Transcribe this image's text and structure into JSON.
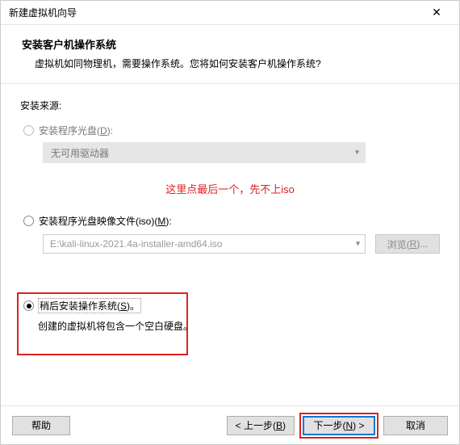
{
  "window": {
    "title": "新建虚拟机向导"
  },
  "header": {
    "title": "安装客户机操作系统",
    "subtitle": "虚拟机如同物理机，需要操作系统。您将如何安装客户机操作系统?"
  },
  "source_label": "安装来源:",
  "opt1": {
    "label_pre": "安装程序光盘(",
    "hotkey": "D",
    "label_post": "):",
    "drive": "无可用驱动器"
  },
  "annotation": "这里点最后一个，先不上iso",
  "opt2": {
    "label_pre": "安装程序光盘映像文件(iso)(",
    "hotkey": "M",
    "label_post": "):",
    "path": "E:\\kali-linux-2021.4a-installer-amd64.iso",
    "browse_pre": "浏览(",
    "browse_hot": "R",
    "browse_post": ")..."
  },
  "opt3": {
    "label_pre": "稍后安装操作系统(",
    "hotkey": "S",
    "label_post": ")。",
    "desc": "创建的虚拟机将包含一个空白硬盘。"
  },
  "footer": {
    "help": "帮助",
    "back_pre": "< 上一步(",
    "back_hot": "B",
    "back_post": ")",
    "next_pre": "下一步(",
    "next_hot": "N",
    "next_post": ") >",
    "cancel": "取消"
  }
}
